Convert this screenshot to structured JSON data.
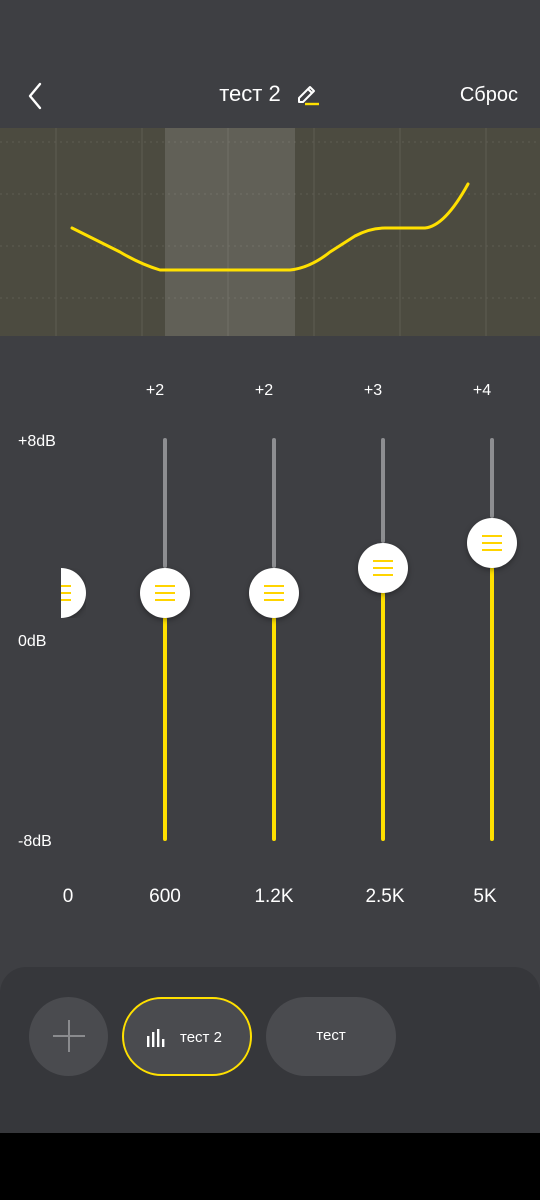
{
  "header": {
    "title": "тест 2",
    "reset_label": "Сброс",
    "back_icon": "chevron-left-icon",
    "edit_icon": "pencil-icon"
  },
  "colors": {
    "background": "#3e3f43",
    "accent": "#ffe000",
    "track": "#8d8e91",
    "graph_bg": "#4c4b40",
    "panel": "#36373b"
  },
  "eq": {
    "db_labels": {
      "top": "+8dB",
      "middle": "0dB",
      "bottom": "-8dB"
    },
    "range_db": [
      -8,
      8
    ],
    "bands": [
      {
        "freq": "0",
        "gain": 2,
        "gain_label": ""
      },
      {
        "freq": "600",
        "gain": 2,
        "gain_label": "+2"
      },
      {
        "freq": "1.2K",
        "gain": 2,
        "gain_label": "+2"
      },
      {
        "freq": "2.5K",
        "gain": 3,
        "gain_label": "+3"
      },
      {
        "freq": "5K",
        "gain": 4,
        "gain_label": "+4"
      }
    ]
  },
  "presets": {
    "add_icon": "plus-icon",
    "items": [
      {
        "label": "тест 2",
        "icon": "equalizer-bars-icon",
        "active": true
      },
      {
        "label": "тест",
        "active": false
      }
    ]
  }
}
